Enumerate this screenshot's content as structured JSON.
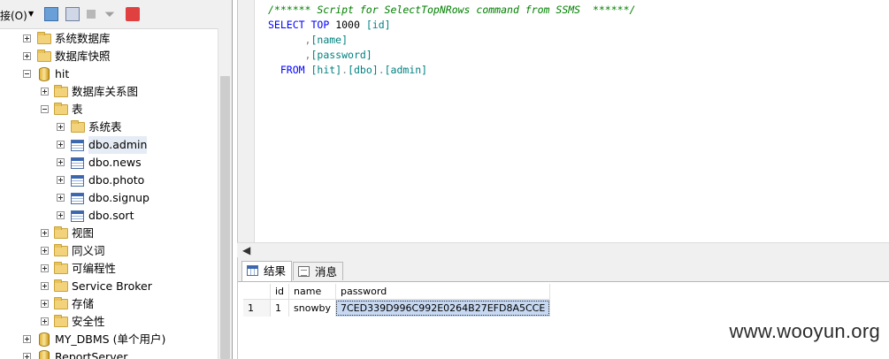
{
  "toolbar": {
    "connect_label": "接(O)"
  },
  "tree": {
    "system_databases": "系统数据库",
    "db_snapshots": "数据库快照",
    "hit": "hit",
    "db_diagrams": "数据库关系图",
    "tables": "表",
    "system_tables": "系统表",
    "dbo_admin": "dbo.admin",
    "dbo_news": "dbo.news",
    "dbo_photo": "dbo.photo",
    "dbo_signup": "dbo.signup",
    "dbo_sort": "dbo.sort",
    "views": "视图",
    "synonyms": "同义词",
    "programmability": "可编程性",
    "service_broker": "Service Broker",
    "storage": "存储",
    "security": "安全性",
    "my_dbms": "MY_DBMS (单个用户)",
    "report_server": "ReportServer"
  },
  "editor": {
    "line1": "/****** Script for SelectTopNRows command from SSMS  ******/",
    "select_kw": "SELECT",
    "top_kw": "TOP",
    "top_n": "1000",
    "col_id": "[id]",
    "col_name": "[name]",
    "col_password": "[password]",
    "from_kw": "FROM",
    "from_db": "[hit]",
    "from_schema": "[dbo]",
    "from_table": "[admin]"
  },
  "results": {
    "tab_results": "结果",
    "tab_messages": "消息",
    "columns": [
      "id",
      "name",
      "password"
    ],
    "rows": [
      {
        "rownum": "1",
        "id": "1",
        "name": "snowby",
        "password": "7CED339D996C992E0264B27EFD8A5CCE"
      }
    ]
  },
  "watermark": "www.wooyun.org"
}
